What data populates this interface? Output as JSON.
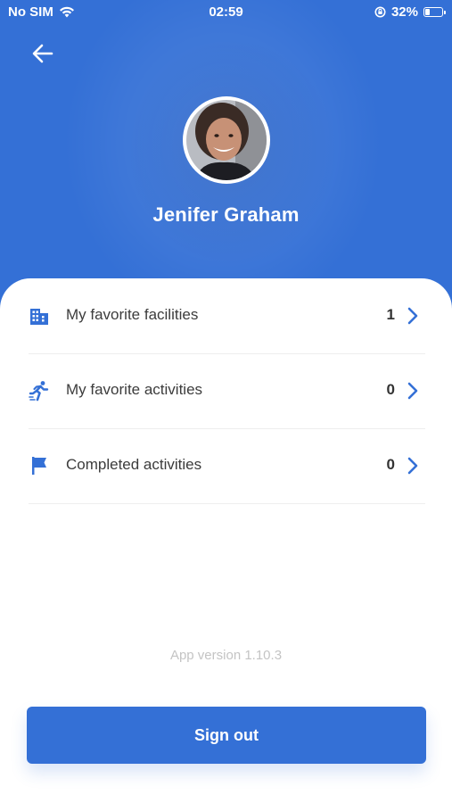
{
  "status_bar": {
    "carrier": "No SIM",
    "time": "02:59",
    "battery_percent": "32%",
    "battery_level": 0.32
  },
  "header": {
    "back_icon": "arrow-left-icon",
    "profile_name": "Jenifer Graham",
    "background_color": "#3470d6"
  },
  "menu": {
    "items": [
      {
        "icon": "building-icon",
        "label": "My favorite facilities",
        "count": "1"
      },
      {
        "icon": "running-person-icon",
        "label": "My favorite activities",
        "count": "0"
      },
      {
        "icon": "flag-icon",
        "label": "Completed activities",
        "count": "0"
      }
    ]
  },
  "footer": {
    "app_version": "App version 1.10.3",
    "sign_out_label": "Sign out"
  },
  "colors": {
    "accent": "#3470d6",
    "text": "#3c3c3c",
    "muted": "#c4c4c4"
  }
}
